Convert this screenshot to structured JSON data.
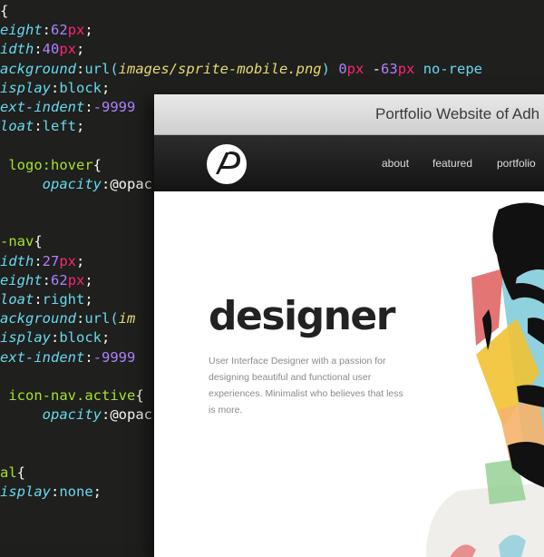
{
  "code_lines": [
    [
      [
        "{",
        "br"
      ]
    ],
    [
      [
        "eight",
        "prop"
      ],
      [
        ":",
        "col"
      ],
      [
        "62",
        "num"
      ],
      [
        "px",
        "unit"
      ],
      [
        ";",
        "pun"
      ]
    ],
    [
      [
        "idth",
        "prop"
      ],
      [
        ":",
        "col"
      ],
      [
        "40",
        "num"
      ],
      [
        "px",
        "unit"
      ],
      [
        ";",
        "pun"
      ]
    ],
    [
      [
        "ackground",
        "prop"
      ],
      [
        ":",
        "col"
      ],
      [
        "url(",
        "kw"
      ],
      [
        "images/sprite-mobile.png",
        "str"
      ],
      [
        ")",
        "kw"
      ],
      [
        " ",
        "pun"
      ],
      [
        "0",
        "num"
      ],
      [
        "px",
        "unit"
      ],
      [
        " -",
        "pun"
      ],
      [
        "63",
        "num"
      ],
      [
        "px",
        "unit"
      ],
      [
        " no-repe",
        "kw"
      ]
    ],
    [
      [
        "isplay",
        "prop"
      ],
      [
        ":",
        "col"
      ],
      [
        "block",
        "kw"
      ],
      [
        ";",
        "pun"
      ]
    ],
    [
      [
        "ext-indent",
        "prop"
      ],
      [
        ":",
        "col"
      ],
      [
        "-9999",
        "num"
      ]
    ],
    [
      [
        "loat",
        "prop"
      ],
      [
        ":",
        "col"
      ],
      [
        "left",
        "kw"
      ],
      [
        ";",
        "pun"
      ]
    ],
    [
      [
        "",
        "pun"
      ]
    ],
    [
      [
        " logo:hover",
        "sel"
      ],
      [
        "{",
        "br"
      ]
    ],
    [
      [
        "     opacity",
        "prop"
      ],
      [
        ":",
        "col"
      ],
      [
        "@opac",
        "var"
      ]
    ],
    [
      [
        "",
        "pun"
      ]
    ],
    [
      [
        "",
        "pun"
      ]
    ],
    [
      [
        "-nav",
        "sel"
      ],
      [
        "{",
        "br"
      ]
    ],
    [
      [
        "idth",
        "prop"
      ],
      [
        ":",
        "col"
      ],
      [
        "27",
        "num"
      ],
      [
        "px",
        "unit"
      ],
      [
        ";",
        "pun"
      ]
    ],
    [
      [
        "eight",
        "prop"
      ],
      [
        ":",
        "col"
      ],
      [
        "62",
        "num"
      ],
      [
        "px",
        "unit"
      ],
      [
        ";",
        "pun"
      ]
    ],
    [
      [
        "loat",
        "prop"
      ],
      [
        ":",
        "col"
      ],
      [
        "right",
        "kw"
      ],
      [
        ";",
        "pun"
      ]
    ],
    [
      [
        "ackground",
        "prop"
      ],
      [
        ":",
        "col"
      ],
      [
        "url(",
        "kw"
      ],
      [
        "im",
        "str"
      ]
    ],
    [
      [
        "isplay",
        "prop"
      ],
      [
        ":",
        "col"
      ],
      [
        "block",
        "kw"
      ],
      [
        ";",
        "pun"
      ]
    ],
    [
      [
        "ext-indent",
        "prop"
      ],
      [
        ":",
        "col"
      ],
      [
        "-9999",
        "num"
      ]
    ],
    [
      [
        "",
        "pun"
      ]
    ],
    [
      [
        " icon-nav.active",
        "sel"
      ],
      [
        "{",
        "br"
      ]
    ],
    [
      [
        "     opacity",
        "prop"
      ],
      [
        ":",
        "col"
      ],
      [
        "@opac",
        "var"
      ]
    ],
    [
      [
        "",
        "pun"
      ]
    ],
    [
      [
        "",
        "pun"
      ]
    ],
    [
      [
        "al",
        "sel"
      ],
      [
        "{",
        "br"
      ]
    ],
    [
      [
        "isplay",
        "prop"
      ],
      [
        ":",
        "col"
      ],
      [
        "none",
        "kw"
      ],
      [
        ";",
        "pun"
      ]
    ],
    [
      [
        "",
        "pun"
      ]
    ]
  ],
  "browser": {
    "title": "Portfolio Website of Adh",
    "nav": {
      "about": "about",
      "featured": "featured",
      "portfolio": "portfolio"
    },
    "hero": {
      "heading": "designer",
      "tagline": "User Interface Designer with a passion for designing beautiful and functional user experiences. Minimalist who believes that less is more."
    }
  }
}
